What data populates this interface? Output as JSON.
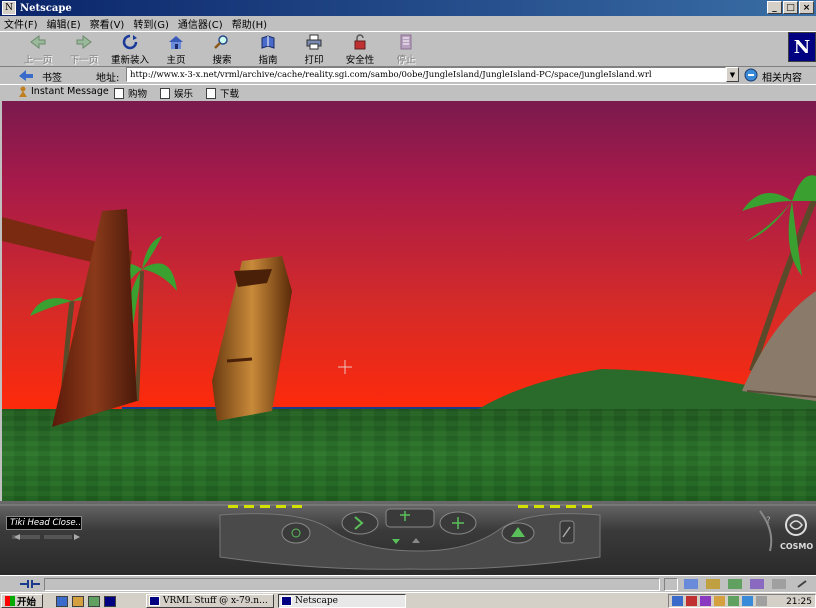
{
  "window": {
    "title": "Netscape",
    "icon_glyph": "N",
    "controls": {
      "minimize": "_",
      "maximize": "□",
      "close": "×"
    }
  },
  "menu": [
    "文件(F)",
    "编辑(E)",
    "察看(V)",
    "转到(G)",
    "通信器(C)",
    "帮助(H)"
  ],
  "toolbar": {
    "back": "上一页",
    "forward": "下一页",
    "reload": "重新装入",
    "home": "主页",
    "search": "搜索",
    "guide": "指南",
    "print": "打印",
    "security": "安全性",
    "stop": "停止",
    "brand": "N"
  },
  "location": {
    "bookmarks_label": "书签",
    "address_label": "地址:",
    "url": "http://www.x-3-x.net/vrml/archive/cache/reality.sgi.com/sambo/0obe/JungleIsland/JungleIsland-PC/space/jungleIsland.wrl",
    "dropdown_glyph": "▼",
    "related_label": "相关内容"
  },
  "personal_toolbar": [
    "Instant Message",
    "购物",
    "娱乐",
    "下载"
  ],
  "vrml_player": {
    "viewpoint_name": "Tiki Head Close...",
    "brand": "COSMO"
  },
  "taskbar": {
    "start_label": "开始",
    "tasks": [
      "VRML Stuff @ x-79.n...",
      "Netscape"
    ],
    "clock": "21:25"
  },
  "colors": {
    "title_start": "#0a246a",
    "title_end": "#3a6ea5",
    "sky_top": "#7a1a4e",
    "sky_bottom": "#ff3a00",
    "ground": "#2a6a2a",
    "lime_led": "#d4e000"
  }
}
